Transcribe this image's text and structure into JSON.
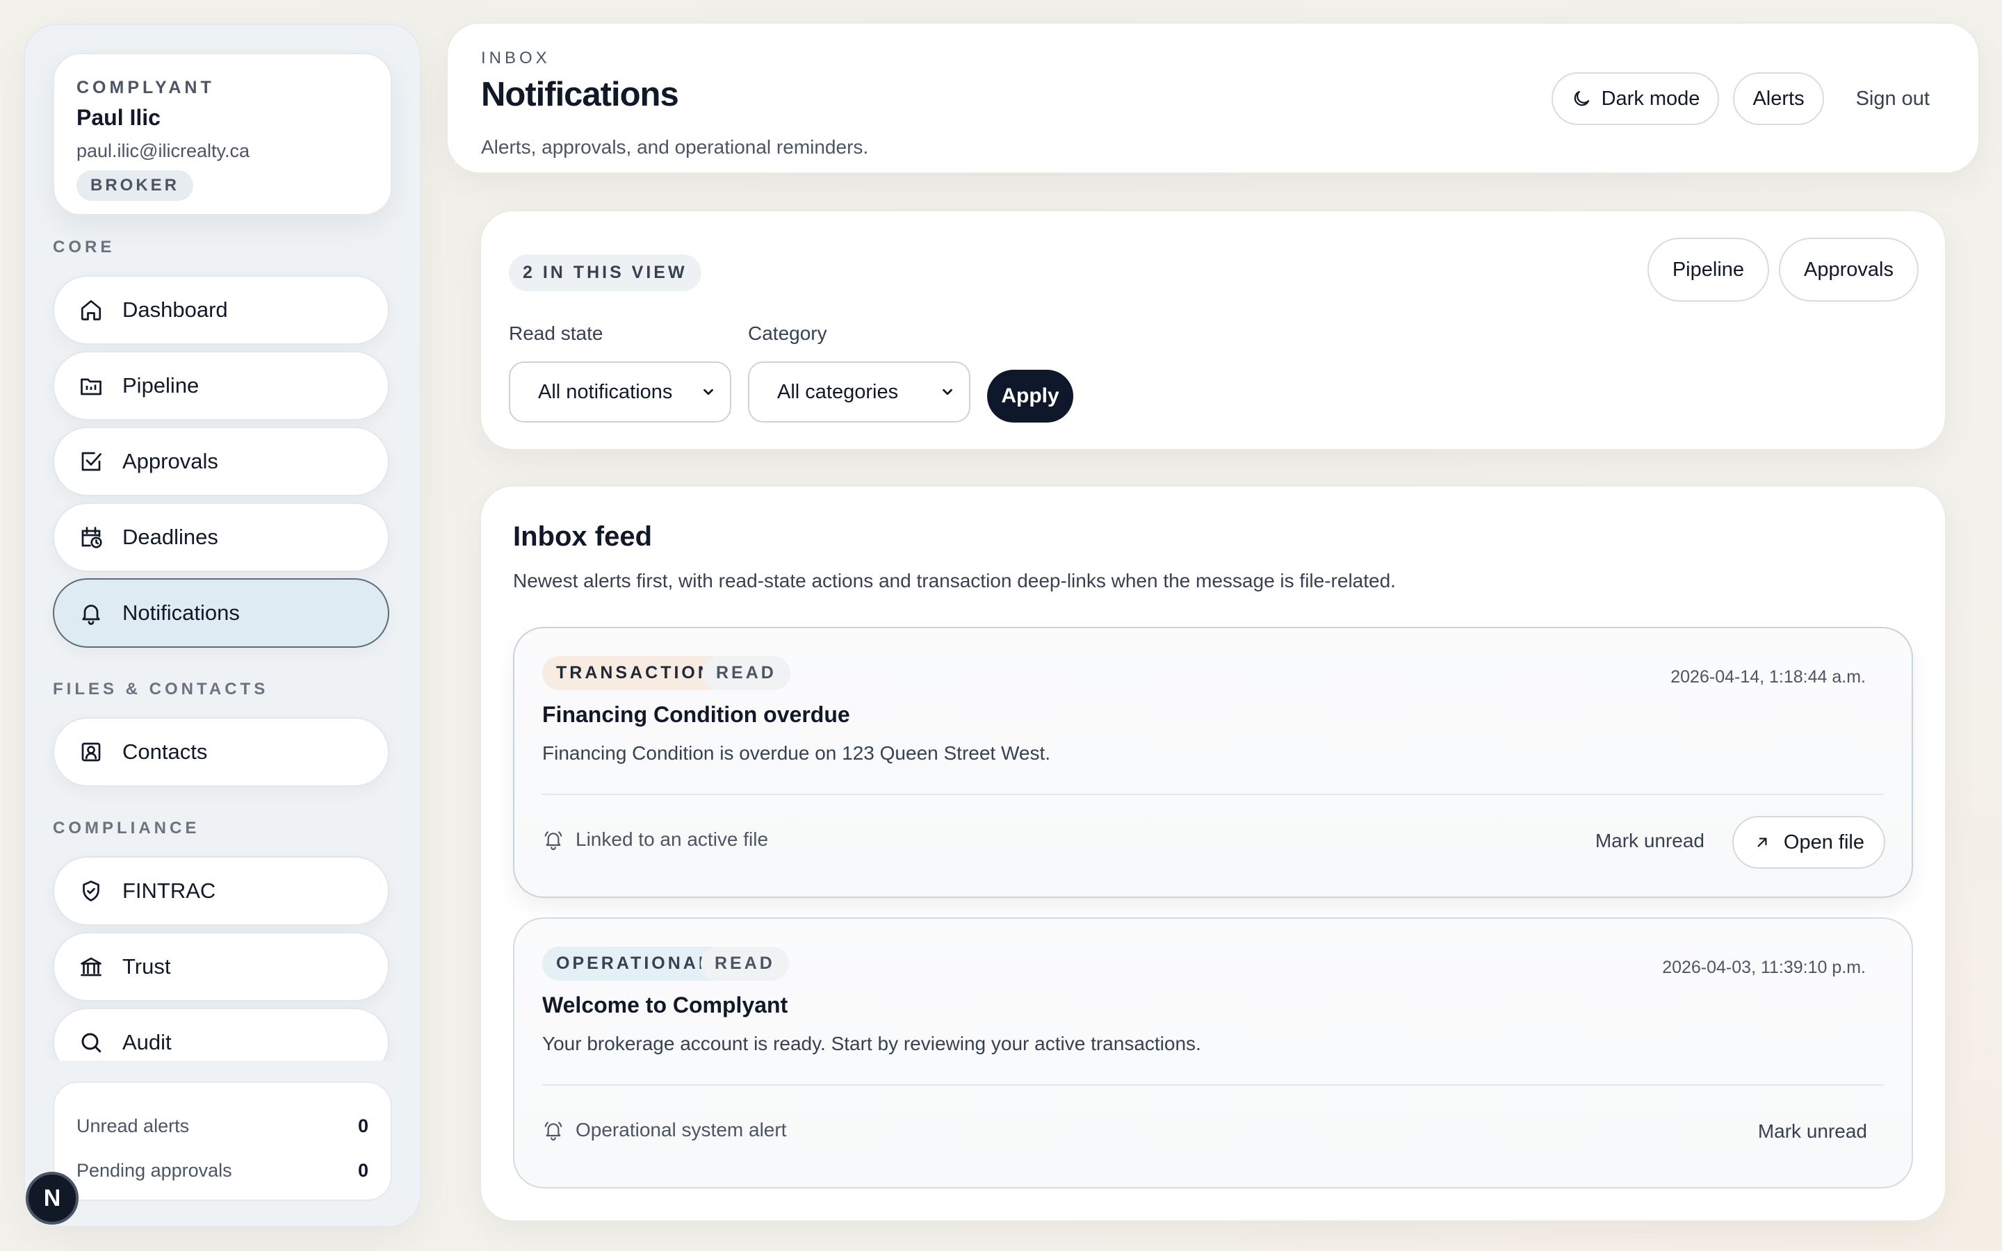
{
  "sidebar": {
    "brand": "COMPLYANT",
    "user_name": "Paul Ilic",
    "user_email": "paul.ilic@ilicrealty.ca",
    "role": "BROKER",
    "sections": [
      {
        "label": "CORE",
        "items": [
          {
            "label": "Dashboard",
            "icon": "home-icon"
          },
          {
            "label": "Pipeline",
            "icon": "pipeline-folder-icon"
          },
          {
            "label": "Approvals",
            "icon": "checkbox-icon"
          },
          {
            "label": "Deadlines",
            "icon": "calendar-clock-icon"
          },
          {
            "label": "Notifications",
            "icon": "bell-icon",
            "active": true
          }
        ]
      },
      {
        "label": "FILES & CONTACTS",
        "items": [
          {
            "label": "Contacts",
            "icon": "contact-card-icon"
          }
        ]
      },
      {
        "label": "COMPLIANCE",
        "items": [
          {
            "label": "FINTRAC",
            "icon": "shield-check-icon"
          },
          {
            "label": "Trust",
            "icon": "bank-icon"
          },
          {
            "label": "Audit",
            "icon": "search-icon"
          }
        ]
      }
    ],
    "stats": [
      {
        "label": "Unread alerts",
        "value": "0"
      },
      {
        "label": "Pending approvals",
        "value": "0"
      }
    ],
    "floating_badge": "N"
  },
  "header": {
    "eyebrow": "INBOX",
    "title": "Notifications",
    "subtitle": "Alerts, approvals, and operational reminders.",
    "dark_mode_label": "Dark mode",
    "alerts_label": "Alerts",
    "sign_out_label": "Sign out"
  },
  "filters": {
    "count_badge": "2 IN THIS VIEW",
    "pipeline_label": "Pipeline",
    "approvals_label": "Approvals",
    "read_state_label": "Read state",
    "read_state_value": "All notifications",
    "category_label": "Category",
    "category_value": "All categories",
    "apply_label": "Apply"
  },
  "feed": {
    "title": "Inbox feed",
    "subtitle": "Newest alerts first, with read-state actions and transaction deep-links when the message is file-related.",
    "items": [
      {
        "category": "TRANSACTION",
        "state": "READ",
        "timestamp": "2026-04-14, 1:18:44 a.m.",
        "title": "Financing Condition overdue",
        "body": "Financing Condition is overdue on 123 Queen Street West.",
        "footer": "Linked to an active file",
        "mark_label": "Mark unread",
        "open_label": "Open file"
      },
      {
        "category": "OPERATIONAL",
        "state": "READ",
        "timestamp": "2026-04-03, 11:39:10 p.m.",
        "title": "Welcome to Complyant",
        "body": "Your brokerage account is ready. Start by reviewing your active transactions.",
        "footer": "Operational system alert",
        "mark_label": "Mark unread"
      }
    ]
  },
  "colors": {
    "accent_dark": "#0f172a",
    "active_nav_bg": "#deebf2",
    "transaction_tag_bg": "#f7ebe2",
    "operational_tag_bg": "#e5f0f6"
  }
}
